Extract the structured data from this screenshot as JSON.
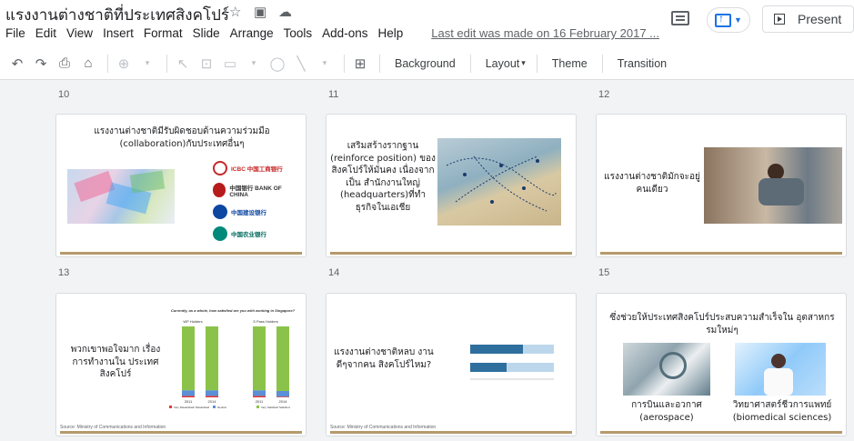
{
  "header": {
    "title": "แรงงานต่างชาติที่ประเทศสิงคโปร์",
    "menu": [
      "File",
      "Edit",
      "View",
      "Insert",
      "Format",
      "Slide",
      "Arrange",
      "Tools",
      "Add-ons",
      "Help"
    ],
    "last_edit": "Last edit was made on 16 February 2017 ...",
    "present_label": "Present"
  },
  "toolbar": {
    "background": "Background",
    "layout": "Layout",
    "theme": "Theme",
    "transition": "Transition"
  },
  "slides": [
    {
      "num": "10",
      "text": "แรงงานต่างชาติมีรับผิดชอบด้านความร่วมมือ (collaboration)กับประเทศอื่นๆ",
      "logos": [
        "ICBC 中国工商银行",
        "中国银行 BANK OF CHINA",
        "中国建设银行",
        "中国农业银行"
      ]
    },
    {
      "num": "11",
      "text": "เสริมสร้างรากฐาน (reinforce position) ของสิงคโปร์ให้มั่นคง เนื่องจากเป็น สำนักงานใหญ่ (headquarters)ที่ทำธุรกิจในเอเชีย"
    },
    {
      "num": "12",
      "text": "แรงงานต่างชาติมักจะอยู่คนเดียว"
    },
    {
      "num": "13",
      "text": "พวกเขาพอใจมาก เรื่องการทำงานใน ประเทศสิงคโปร์",
      "chart_title": "Currently, as a whole, how satisfied are you with working in Singapore?",
      "group_left": "WP Holders",
      "group_right": "S Pass Holders",
      "source": "Source: Ministry of Communications and Information"
    },
    {
      "num": "14",
      "text": "แรงงานต่างชาติหลบ งานดีๆจากคน สิงคโปร์ไหม?",
      "source": "Source: Ministry of Communications and Information"
    },
    {
      "num": "15",
      "text": "ซึ่งช่วยให้ประเทศสิงคโปร์ประสบความสำเร็จใน อุตสาหกรรมใหม่ๆ",
      "left_caption_th": "การบินและอวกาศ",
      "left_caption_en": "(aerospace)",
      "right_caption_th": "วิทยาศาสตร์ชีวการแพทย์",
      "right_caption_en": "(biomedical sciences)"
    }
  ],
  "chart_data": {
    "type": "bar",
    "title": "Currently, as a whole, how satisfied are you with working in Singapore?",
    "categories": [
      "2011",
      "2014",
      "2011",
      "2014"
    ],
    "series": [
      {
        "name": "Very Dissatisfied/ Dissatisfied",
        "values": [
          2,
          2,
          2,
          1
        ]
      },
      {
        "name": "Neutral",
        "values": [
          8,
          8,
          8,
          8
        ]
      },
      {
        "name": "Very Satisfied/ Satisfied",
        "values": [
          90,
          90,
          90,
          91
        ]
      }
    ],
    "colors": [
      "#e53935",
      "#5b8fd6",
      "#8bc34a"
    ]
  },
  "colors": {
    "accent": "#1a73e8",
    "gold": "#b59a6b"
  }
}
